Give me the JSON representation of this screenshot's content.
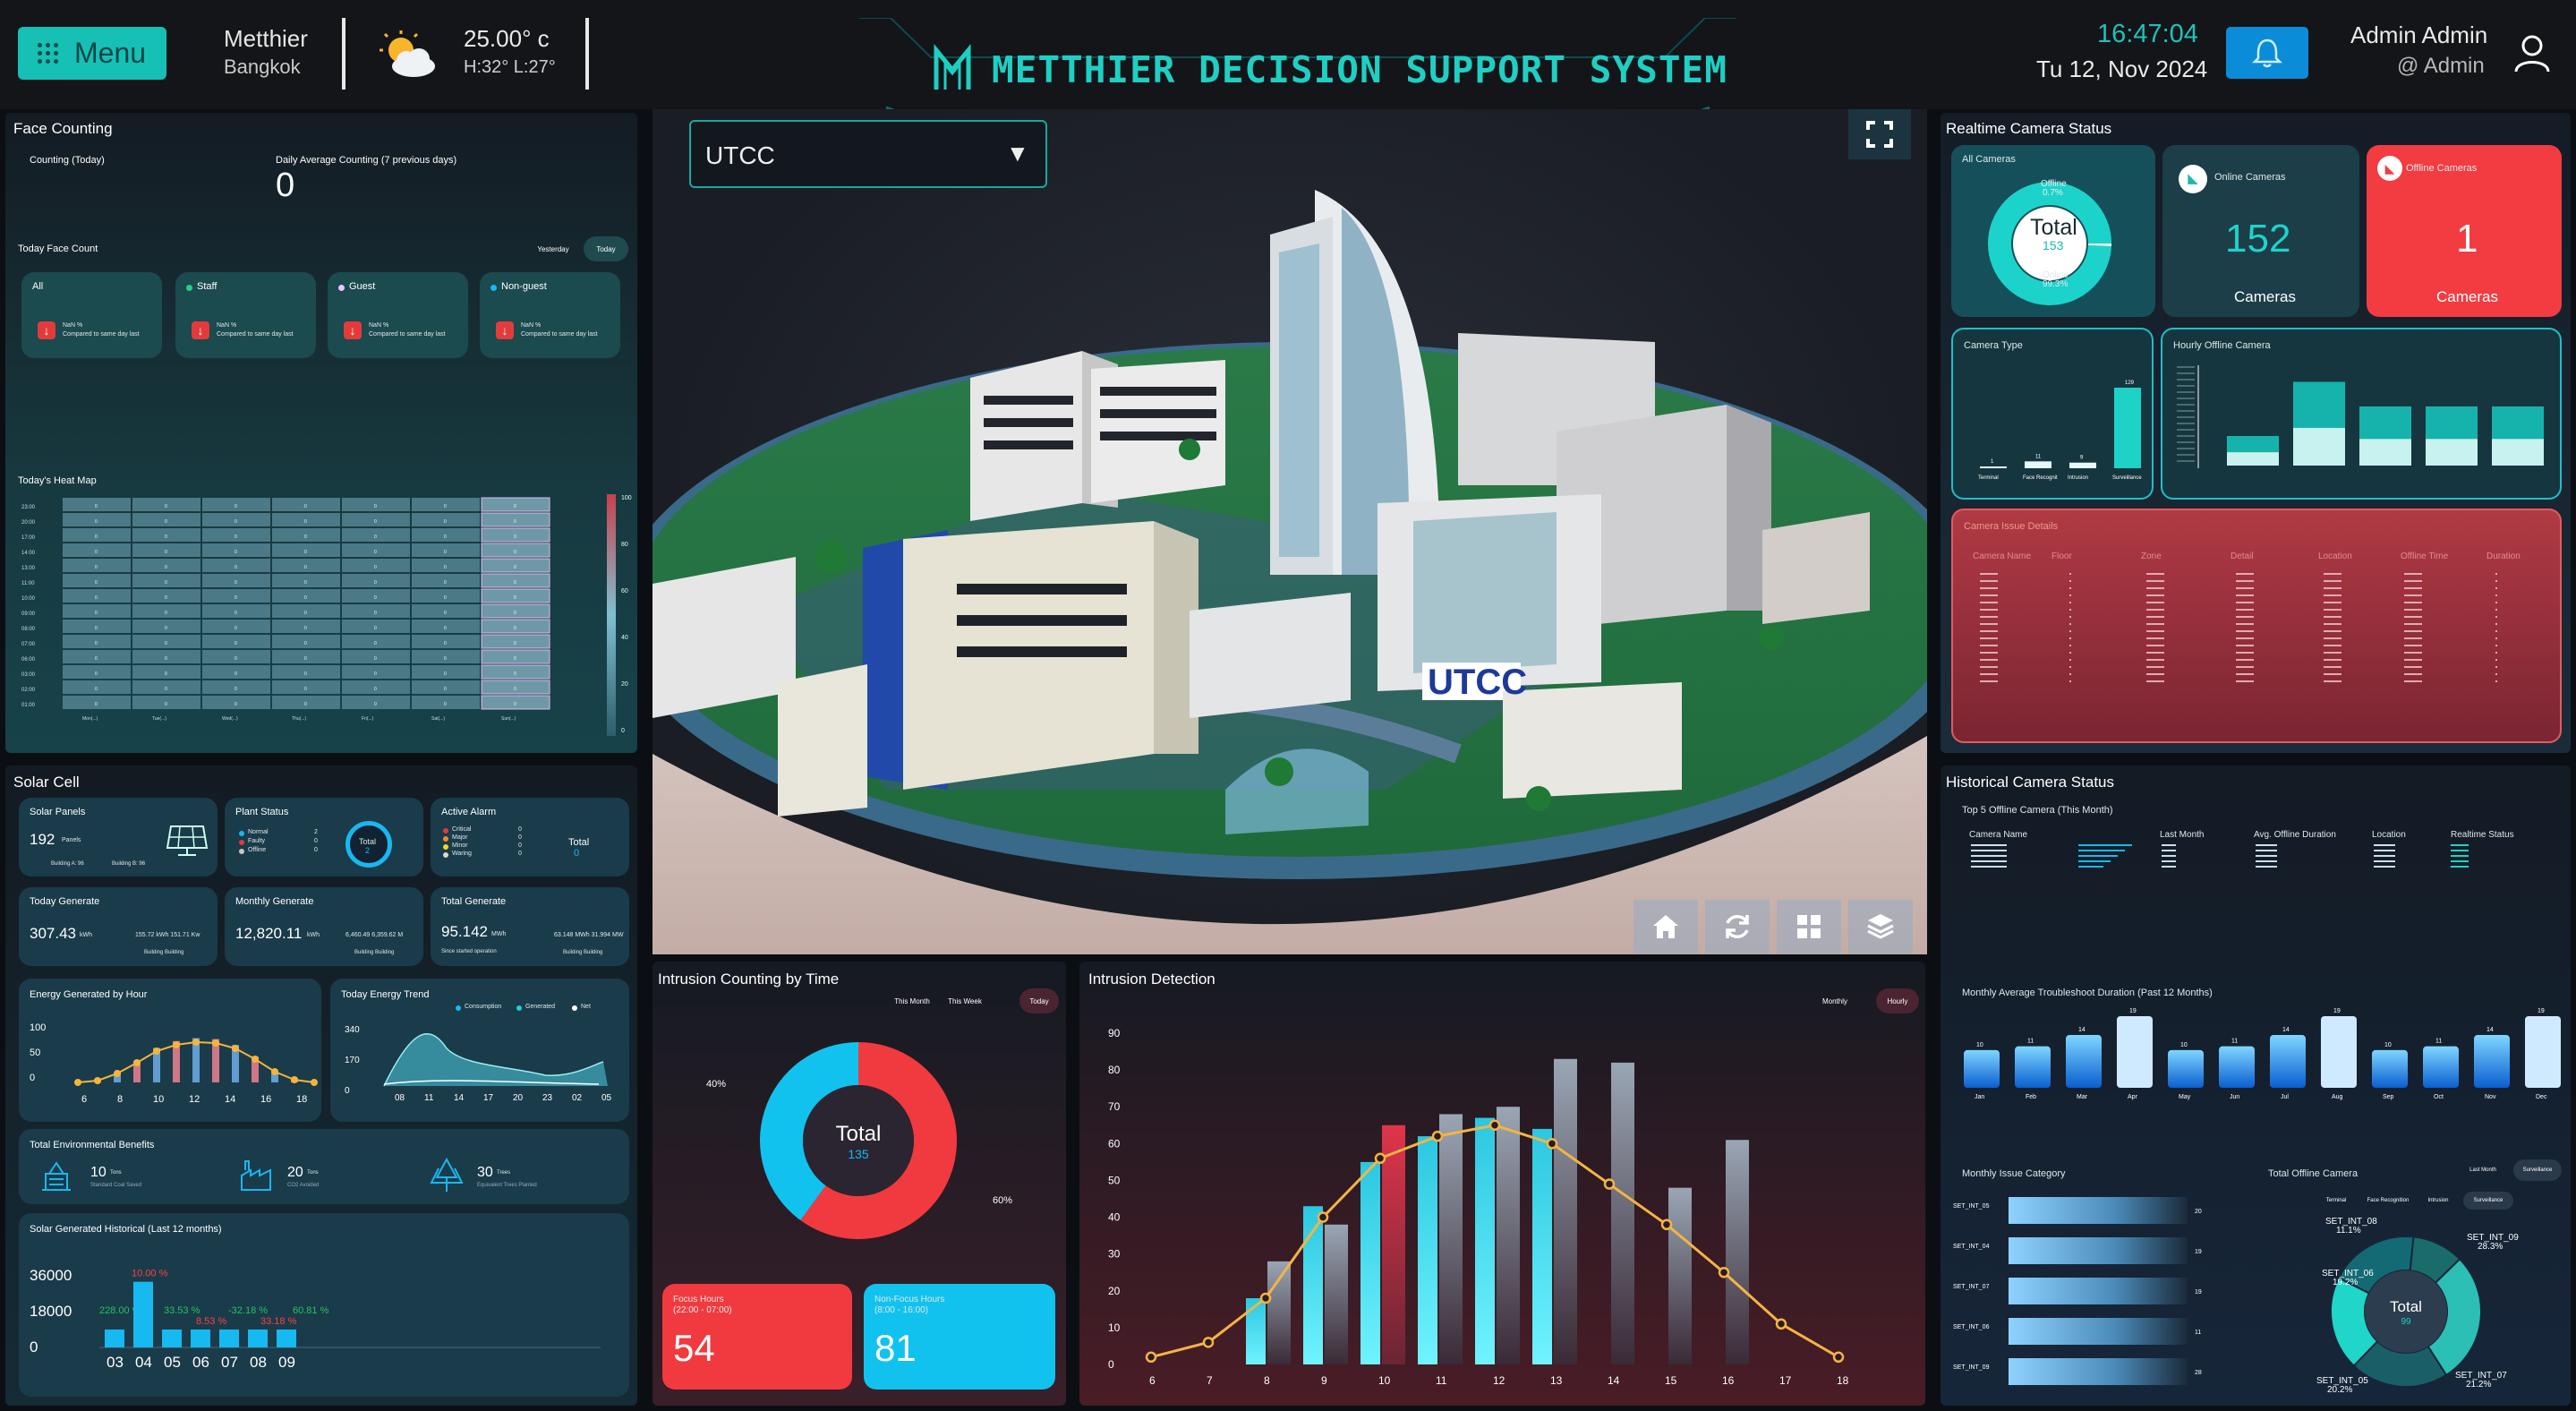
{
  "header": {
    "menu_label": "Menu",
    "location_name": "Metthier",
    "location_city": "Bangkok",
    "temperature": "25.00° c",
    "temp_range": "H:32° L:27°",
    "title": "METTHIER DECISION SUPPORT SYSTEM",
    "time": "16:47:04",
    "date": "Tu 12, Nov 2024",
    "user_name": "Admin Admin",
    "user_handle": "@ Admin",
    "icons": [
      "menu-grid-icon",
      "weather-sun-cloud-icon",
      "metthier-logo",
      "bell-icon",
      "user-icon"
    ]
  },
  "face_counting": {
    "title": "Face Counting",
    "counting_today_label": "Counting (Today)",
    "daily_avg_label": "Daily Average Counting (7 previous days)",
    "daily_avg_value": "0",
    "today_face_count_label": "Today Face Count",
    "tabs": [
      "Yesterday",
      "Today"
    ],
    "categories": [
      {
        "name": "All",
        "percent": "NaN %",
        "note": "Compared to same day last"
      },
      {
        "name": "Staff",
        "percent": "NaN %",
        "note": "Compared to same day last"
      },
      {
        "name": "Guest",
        "percent": "NaN %",
        "note": "Compared to same day last"
      },
      {
        "name": "Non-guest",
        "percent": "NaN %",
        "note": "Compared to same day last"
      }
    ],
    "heatmap_title": "Today's Heat Map",
    "heatmap_rows": [
      "23:00",
      "20:00",
      "17:00",
      "14:00",
      "13:00",
      "11:00",
      "10:00",
      "09:00",
      "08:00",
      "07:00",
      "06:00",
      "03:00",
      "02:00",
      "01:00"
    ],
    "heatmap_cols": [
      "Mon(...)",
      "Tue(...)",
      "Wed(...)",
      "Thu(...)",
      "Fri(...)",
      "Sat(...)",
      "Sun(...)"
    ],
    "heatmap_cell": "0",
    "legend_ticks": [
      "100",
      "80",
      "60",
      "40",
      "20",
      "0"
    ]
  },
  "solar": {
    "title": "Solar Cell",
    "panels_label": "Solar Panels",
    "panels_value": "192",
    "panels_unit": "Panels",
    "panels_legend": [
      "Building A: 96",
      "Building B: 96"
    ],
    "plant_status_label": "Plant Status",
    "plant_status_items": [
      {
        "name": "Normal",
        "value": "2"
      },
      {
        "name": "Faulty",
        "value": "0"
      },
      {
        "name": "Offline",
        "value": "0"
      }
    ],
    "plant_total_label": "Total",
    "plant_total_value": "2",
    "alarm_label": "Active Alarm",
    "alarm_items": [
      {
        "name": "Critical",
        "value": "0"
      },
      {
        "name": "Major",
        "value": "0"
      },
      {
        "name": "Minor",
        "value": "0"
      },
      {
        "name": "Waring",
        "value": "0"
      }
    ],
    "alarm_total_label": "Total",
    "alarm_total_value": "0",
    "today_gen_label": "Today Generate",
    "today_gen_value": "307.43",
    "today_gen_unit": "kWh",
    "today_gen_sub": "155.72 kWh 151.71 Kw",
    "today_gen_sub2": "Building Building",
    "monthly_gen_label": "Monthly Generate",
    "monthly_gen_value": "12,820.11",
    "monthly_gen_unit": "kWh",
    "monthly_gen_sub": "6,460.49 6,359.62 M",
    "monthly_gen_sub2": "Building Building",
    "total_gen_label": "Total Generate",
    "total_gen_value": "95.142",
    "total_gen_unit": "MWh",
    "total_gen_sub": "Since started operation",
    "total_gen_sub2": "63.148 MWh 31.994 MW",
    "total_gen_sub3": "Building Building",
    "energy_hour_label": "Energy Generated by Hour",
    "energy_trend_label": "Today Energy Trend",
    "trend_legend": [
      "Consumption",
      "Generated",
      "Net"
    ],
    "env_label": "Total Environmental Benefits",
    "env_items": [
      {
        "value": "10",
        "unit": "Tons",
        "desc": "Standard Coal Saved"
      },
      {
        "value": "20",
        "unit": "Tons",
        "desc": "CO2 Avoided"
      },
      {
        "value": "30",
        "unit": "Trees",
        "desc": "Equivalent Trees Planted"
      }
    ],
    "historical_label": "Solar Generated Historical (Last 12 months)"
  },
  "campus": {
    "selector_value": "UTCC",
    "sign_text": "UTCC",
    "controls": [
      "home-icon",
      "refresh-icon",
      "grid-icon",
      "layers-icon"
    ]
  },
  "intrusion_time": {
    "title": "Intrusion Counting by Time",
    "tabs": [
      "This Month",
      "This Week",
      "Today"
    ],
    "total_label": "Total",
    "total_value": "135",
    "pct_left": "40%",
    "pct_right": "60%",
    "focus_label": "Focus Hours",
    "focus_range": "(22:00 - 07:00)",
    "focus_value": "54",
    "nonfocus_label": "Non-Focus Hours",
    "nonfocus_range": "(8:00 - 16:00)",
    "nonfocus_value": "81"
  },
  "intrusion_detect": {
    "title": "Intrusion Detection",
    "tabs": [
      "Monthly",
      "Hourly"
    ]
  },
  "camera_status": {
    "title": "Realtime Camera Status",
    "all_label": "All Cameras",
    "donut_total_label": "Total",
    "donut_total_value": "153",
    "donut_offline_label": "Offline",
    "donut_offline_pct": "0.7%",
    "donut_online_label": "Online",
    "donut_online_pct": "99.3%",
    "online_label": "Online Cameras",
    "online_value": "152",
    "online_unit": "Cameras",
    "offline_label": "Offline Cameras",
    "offline_value": "1",
    "offline_unit": "Cameras",
    "type_label": "Camera Type",
    "type_bars": [
      {
        "name": "Terminal",
        "value": "1"
      },
      {
        "name": "Face Recognit",
        "value": "11"
      },
      {
        "name": "Intrusion",
        "value": "9"
      },
      {
        "name": "Surveillance",
        "value": "129"
      }
    ],
    "hourly_label": "Hourly Offline Camera",
    "issue_title": "Camera Issue Details",
    "issue_headers": [
      "Camera Name",
      "Floor",
      "Zone",
      "Detail",
      "Location",
      "Offline Time",
      "Duration"
    ]
  },
  "historical": {
    "title": "Historical Camera Status",
    "top5_label": "Top 5 Offline Camera (This Month)",
    "top5_headers": [
      "Camera Name",
      "Last Month",
      "Avg. Offline Duration",
      "Location",
      "Realtime Status"
    ],
    "monthly_trouble_label": "Monthly Average Troubleshoot Duration (Past 12 Months)",
    "months": [
      "Jan",
      "Feb",
      "Mar",
      "Apr",
      "May",
      "Jun",
      "Jul",
      "Aug",
      "Sep",
      "Oct",
      "Nov",
      "Dec"
    ],
    "month_values": [
      10,
      11,
      14,
      19,
      10,
      11,
      14,
      19,
      10,
      11,
      14,
      19
    ],
    "issue_cat_label": "Monthly Issue Category",
    "issue_cats": [
      {
        "name": "SET_INT_05",
        "value": "20"
      },
      {
        "name": "SET_INT_04",
        "value": "19"
      },
      {
        "name": "SET_INT_07",
        "value": "19"
      },
      {
        "name": "SET_INT_06",
        "value": "11"
      },
      {
        "name": "SET_INT_09",
        "value": "28"
      }
    ],
    "total_offline_label": "Total Offline Camera",
    "offline_tabs": [
      "Last Month",
      "Surveillance"
    ],
    "offline_type_tabs": [
      "Terminal",
      "Face Recognition",
      "Intrusion"
    ],
    "pie_total_label": "Total",
    "pie_total_value": "99",
    "pie_labels": [
      {
        "name": "SET_INT_08",
        "pct": "11.1%"
      },
      {
        "name": "SET_INT_09",
        "pct": "28.3%"
      },
      {
        "name": "SET_INT_06",
        "pct": "19.2%"
      },
      {
        "name": "SET_INT_05",
        "pct": "20.2%"
      },
      {
        "name": "SET_INT_07",
        "pct": "21.2%"
      }
    ]
  },
  "colors": {
    "accent": "#17b9b0",
    "red": "#f2373f",
    "blue": "#12c2ee",
    "bg": "#0b0f14"
  },
  "chart_data": [
    {
      "type": "bar",
      "title": "Intrusion Detection",
      "categories": [
        "6",
        "7",
        "8",
        "9",
        "10",
        "11",
        "12",
        "13",
        "14",
        "15",
        "16",
        "17",
        "18"
      ],
      "ylim": [
        0,
        90
      ],
      "yticks": [
        "0",
        "10",
        "20",
        "30",
        "40",
        "50",
        "60",
        "70",
        "80",
        "90"
      ],
      "series": [],
      "values_back": [
        0,
        0,
        28,
        38,
        57,
        68,
        70,
        83,
        82,
        48,
        61,
        0,
        0
      ],
      "values_red": [
        0,
        0,
        0,
        0,
        65,
        0,
        0,
        0,
        0,
        0,
        0,
        0,
        0
      ],
      "values_front": [
        0,
        0,
        18,
        43,
        55,
        62,
        67,
        64,
        0,
        0,
        0,
        0,
        0
      ],
      "line": [
        2,
        6,
        18,
        40,
        56,
        62,
        65,
        60,
        49,
        38,
        25,
        11,
        2
      ]
    },
    {
      "type": "bar",
      "title": "Solar Generated Historical (Last 12 months)",
      "categories": [
        "03",
        "04",
        "05",
        "06",
        "07",
        "08",
        "09"
      ],
      "yticks": [
        "0",
        "18000",
        "36000"
      ],
      "values": [
        9000,
        33000,
        9000,
        9000,
        9000,
        9000,
        9000
      ],
      "annotations": [
        "228.00 %",
        "10.00 %",
        "33.53 %",
        "8.53 %",
        "-32.18 %",
        "33.18 %",
        "60.81 %"
      ]
    }
  ]
}
